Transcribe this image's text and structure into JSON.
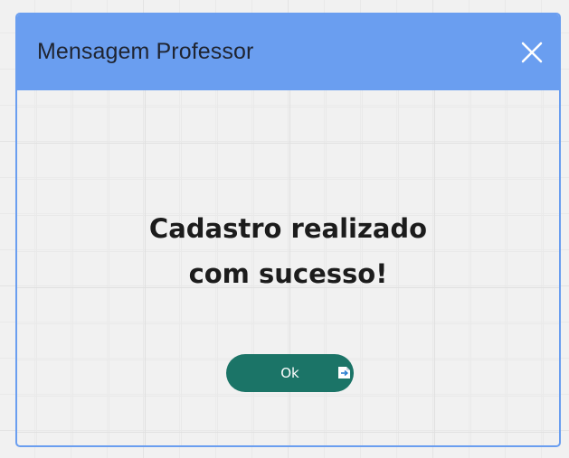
{
  "dialog": {
    "title": "Mensagem Professor",
    "message_line1": "Cadastro realizado",
    "message_line2": "com sucesso!",
    "ok_label": "Ok",
    "close_icon": "close-icon",
    "badge_icon": "arrow-right-badge-icon"
  },
  "colors": {
    "header": "#6a9ef0",
    "button": "#1b7467",
    "text": "#1c1c1c"
  }
}
